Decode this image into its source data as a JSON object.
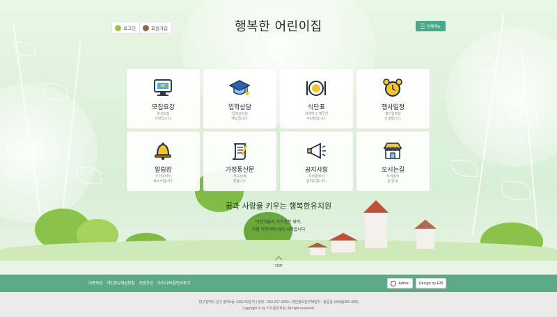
{
  "header": {
    "login_label": "로그인",
    "join_label": "회원가입",
    "site_title": "행복한 어린이집",
    "menu_label": "전체메뉴"
  },
  "cards": [
    {
      "title": "모집요강",
      "desc_line1": "원생모집",
      "desc_line2": "안내입니다.",
      "icon": "monitor-icon"
    },
    {
      "title": "입학상담",
      "desc_line1": "입학상담을",
      "desc_line2": "해드립니다.",
      "icon": "graduation-cap-icon"
    },
    {
      "title": "식단표",
      "desc_line1": "위생하고 깨끗한",
      "desc_line2": "식단표입니다.",
      "icon": "plate-icon"
    },
    {
      "title": "행사일정",
      "desc_line1": "행사일정을",
      "desc_line2": "안내합니다.",
      "icon": "alarm-clock-icon"
    },
    {
      "title": "알림장",
      "desc_line1": "우리아이의",
      "desc_line2": "새소식입니다.",
      "icon": "bell-icon"
    },
    {
      "title": "가정통신문",
      "desc_line1": "부모님께",
      "desc_line2": "전합니다.",
      "icon": "scroll-icon"
    },
    {
      "title": "공지사항",
      "desc_line1": "우리원에서",
      "desc_line2": "알려드립니다.",
      "icon": "megaphone-icon"
    },
    {
      "title": "오시는길",
      "desc_line1": "우리원의",
      "desc_line2": "길 안내.",
      "icon": "shop-icon"
    }
  ],
  "hero": {
    "slogan": "꿈과 사랑을 키우는 행복한유치원",
    "sub1": "어린이들의 가르침은 새싹,",
    "sub2": "가정 어린이와 아이 시작합니다"
  },
  "top_label": "TOP",
  "footer": {
    "links": [
      "이용약관",
      "개인정보취급방침",
      "회원가입",
      "아이디/비밀번호찾기"
    ],
    "admin_label": "Admin",
    "design_label": "Design by EBI",
    "address": "대구광역시 남구 봉덕3동 1293-60번지 | 전화 : 053-267-3300 | 개인정보관리책임자 : 홍길동 (000@000.000)",
    "copyright": "Copyright © by 키즈홈유치원. All right reserved."
  },
  "colors": {
    "accent": "#5daa89",
    "menu": "#47a88a"
  }
}
